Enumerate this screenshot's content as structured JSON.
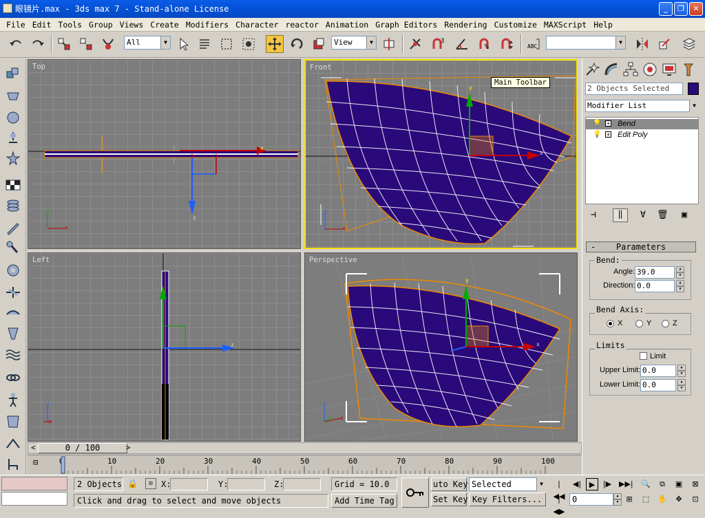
{
  "window": {
    "title": "眼镜片.max - 3ds max 7  - Stand-alone License"
  },
  "menu": [
    "File",
    "Edit",
    "Tools",
    "Group",
    "Views",
    "Create",
    "Modifiers",
    "Character",
    "reactor",
    "Animation",
    "Graph Editors",
    "Rendering",
    "Customize",
    "MAXScript",
    "Help"
  ],
  "toolbar": {
    "selection_filter": "All",
    "ref_coord": "View",
    "named_selection": ""
  },
  "tooltip": "Main Toolbar",
  "viewports": {
    "top": "Top",
    "front": "Front",
    "left": "Left",
    "perspective": "Perspective"
  },
  "axes": {
    "x": "x",
    "y": "y",
    "z": "z"
  },
  "command_panel": {
    "selection_name": "2 Objects Selected",
    "object_color": "#2a0a7a",
    "modifier_list": "Modifier List",
    "stack": [
      "Bend",
      "Edit Poly"
    ],
    "rollout_title": "Parameters",
    "bend_label": "Bend:",
    "angle_label": "Angle:",
    "angle_value": "39.0",
    "direction_label": "Direction:",
    "direction_value": "0.0",
    "bend_axis_label": "Bend Axis:",
    "axis_x": "X",
    "axis_y": "Y",
    "axis_z": "Z",
    "selected_axis": "X",
    "limits_label": "Limits",
    "limit_checkbox": "Limit",
    "upper_label": "Upper Limit:",
    "upper_value": "0.0",
    "lower_label": "Lower Limit:",
    "lower_value": "0.0"
  },
  "timeline": {
    "slider_text": "0 / 100",
    "ticks": [
      "0",
      "10",
      "20",
      "30",
      "40",
      "50",
      "60",
      "70",
      "80",
      "90",
      "100"
    ]
  },
  "status": {
    "selection": "2 Objects",
    "x_label": "X:",
    "y_label": "Y:",
    "z_label": "Z:",
    "grid": "Grid = 10.0",
    "prompt": "Click and drag to select and move objects",
    "add_time_tag": "Add Time Tag",
    "auto_key": "uto Key",
    "set_key": "Set Key",
    "key_mode": "Selected",
    "key_filters": "Key Filters...",
    "frame": "0"
  },
  "colors": {
    "object": "#2a0a7a",
    "active_border": "#f5e100",
    "selection_bbox": "#f08a00"
  }
}
